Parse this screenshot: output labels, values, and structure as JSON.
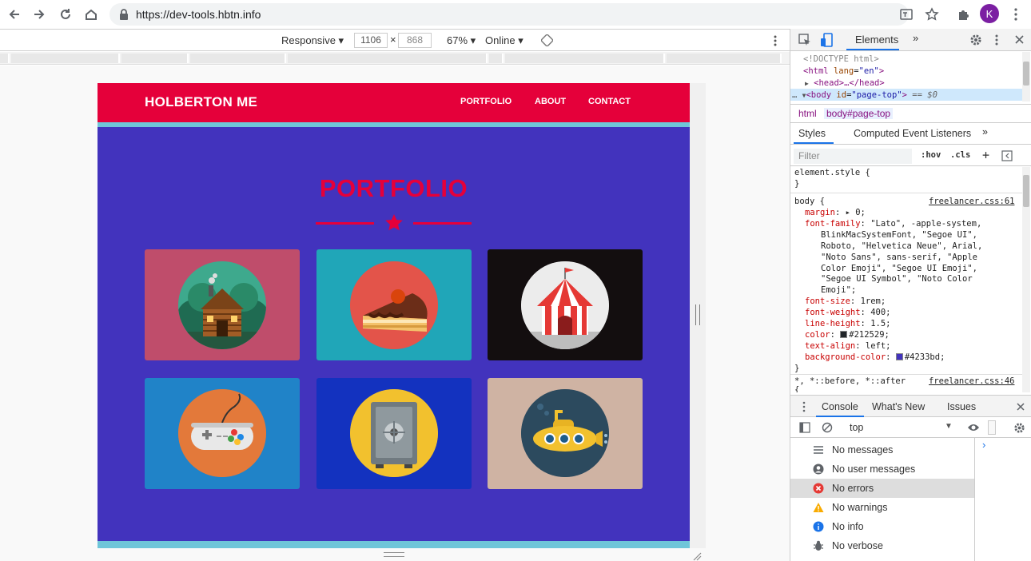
{
  "browser": {
    "url": "https://dev-tools.hbtn.info",
    "profile_initial": "K"
  },
  "device_toolbar": {
    "device": "Responsive",
    "width": "1106",
    "times": "×",
    "height": "868",
    "zoom": "67%",
    "throttle": "Online"
  },
  "site": {
    "brand": "HOLBERTON ME",
    "nav": [
      "PORTFOLIO",
      "ABOUT",
      "CONTACT"
    ],
    "heading": "PORTFOLIO",
    "colors": {
      "primary": "#e5003a",
      "background": "#4233bd",
      "stripe": "#6fc6d9"
    },
    "tiles": [
      {
        "icon": "cabin-icon",
        "bg": "#bf4d6b"
      },
      {
        "icon": "cake-icon",
        "bg": "#20a6b8"
      },
      {
        "icon": "circus-icon",
        "bg": "#130e0f"
      },
      {
        "icon": "game-controller-icon",
        "bg": "#2083c8"
      },
      {
        "icon": "safe-icon",
        "bg": "#1332bf"
      },
      {
        "icon": "submarine-icon",
        "bg": "#cfb3a3"
      }
    ]
  },
  "devtools": {
    "main_tab": "Elements",
    "dom": {
      "doctype": "<!DOCTYPE html>",
      "html_open": "<html",
      "lang_attr": "lang",
      "lang_val": "\"en\"",
      "head": "<head>…</head>",
      "body_tag": "<body",
      "id_attr": "id",
      "id_val": "\"page-top\"",
      "eq": "== $0"
    },
    "breadcrumbs": [
      "html",
      "body#page-top"
    ],
    "style_tabs": [
      "Styles",
      "Computed",
      "Event Listeners"
    ],
    "filter_placeholder": "Filter",
    "filter_hov": ":hov",
    "filter_cls": ".cls",
    "styles": {
      "element_style": "element.style {",
      "close": "}",
      "body_selector": "body {",
      "body_source": "freelancer.css:61",
      "props": [
        {
          "name": "margin",
          "value": "▸ 0;"
        },
        {
          "name": "font-family",
          "value": "\"Lato\", -apple-system,"
        },
        {
          "name": "",
          "value": "BlinkMacSystemFont, \"Segoe UI\","
        },
        {
          "name": "",
          "value": "Roboto, \"Helvetica Neue\", Arial,"
        },
        {
          "name": "",
          "value": "\"Noto Sans\", sans-serif, \"Apple"
        },
        {
          "name": "",
          "value": "Color Emoji\", \"Segoe UI Emoji\","
        },
        {
          "name": "",
          "value": "\"Segoe UI Symbol\", \"Noto Color"
        },
        {
          "name": "",
          "value": "Emoji\";"
        },
        {
          "name": "font-size",
          "value": "1rem;"
        },
        {
          "name": "font-weight",
          "value": "400;"
        },
        {
          "name": "line-height",
          "value": "1.5;"
        },
        {
          "name": "color",
          "value": "#212529;"
        },
        {
          "name": "text-align",
          "value": "left;"
        },
        {
          "name": "background-color",
          "value": "#4233bd;"
        }
      ],
      "universal_selector": "*, *::before, *::after",
      "universal_source": "freelancer.css:46",
      "universal_open": "{"
    },
    "drawer_tabs": [
      "Console",
      "What's New",
      "Issues"
    ],
    "console_context": "top",
    "console_filters": [
      {
        "label": "No messages",
        "icon": "list-icon",
        "color": "#5f6368"
      },
      {
        "label": "No user messages",
        "icon": "user-icon",
        "color": "#5f6368"
      },
      {
        "label": "No errors",
        "icon": "error-icon",
        "color": "#e53935"
      },
      {
        "label": "No warnings",
        "icon": "warning-icon",
        "color": "#f9ab00"
      },
      {
        "label": "No info",
        "icon": "info-icon",
        "color": "#1a73e8"
      },
      {
        "label": "No verbose",
        "icon": "bug-icon",
        "color": "#5f6368"
      }
    ],
    "selected_console_filter": "No errors"
  }
}
